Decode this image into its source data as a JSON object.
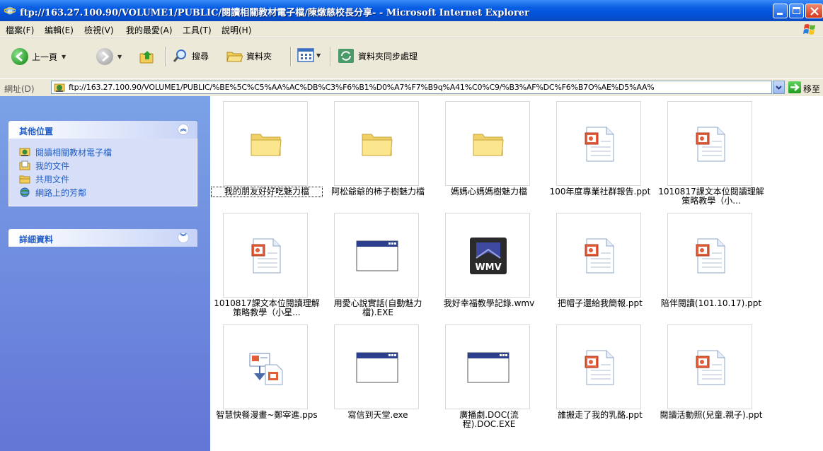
{
  "window": {
    "title": "ftp://163.27.100.90/VOLUME1/PUBLIC/閱讀相關教材電子檔/陳燉慈校長分享- - Microsoft Internet Explorer",
    "icon": "ie-icon"
  },
  "menu": {
    "items": [
      "檔案(F)",
      "編輯(E)",
      "檢視(V)",
      "我的最愛(A)",
      "工具(T)",
      "說明(H)"
    ]
  },
  "toolbar": {
    "back_label": "上一頁",
    "search_label": "搜尋",
    "folders_label": "資料夾",
    "sync_label": "資料夾同步處理"
  },
  "address": {
    "label": "網址(D)",
    "value": "ftp://163.27.100.90/VOLUME1/PUBLIC/%BE%5C%C5%AA%AC%DB%C3%F6%B1%D0%A7%F7%B9q%A41%C0%C9/%B3%AF%DC%F6%B7O%AE%D5%AA%",
    "go_label": "移至"
  },
  "taskpane": {
    "other_places": {
      "title": "其他位置",
      "links": [
        {
          "label": "閱讀相關教材電子檔",
          "icon": "ftp-folder-icon"
        },
        {
          "label": "我的文件",
          "icon": "my-documents-icon"
        },
        {
          "label": "共用文件",
          "icon": "shared-documents-icon"
        },
        {
          "label": "網路上的芳鄰",
          "icon": "network-places-icon"
        }
      ]
    },
    "details": {
      "title": "詳細資料"
    }
  },
  "files": [
    {
      "name": "我的朋友好好吃魅力檔",
      "type": "folder"
    },
    {
      "name": "阿松爺爺的柿子樹魅力檔",
      "type": "folder"
    },
    {
      "name": "媽媽心媽媽樹魅力檔",
      "type": "folder"
    },
    {
      "name": "100年度專業社群報告.ppt",
      "type": "ppt"
    },
    {
      "name": "1010817課文本位閱讀理解策略教學（小...",
      "type": "ppt"
    },
    {
      "name": "1010817課文本位閱讀理解策略教學（小星...",
      "type": "ppt"
    },
    {
      "name": "用愛心說實話(自動魅力檔).EXE",
      "type": "exe"
    },
    {
      "name": "我好幸福教學記錄.wmv",
      "type": "wmv",
      "badge": "WMV"
    },
    {
      "name": "把帽子還給我簡報.ppt",
      "type": "ppt"
    },
    {
      "name": "陪伴閱讀(101.10.17).ppt",
      "type": "ppt"
    },
    {
      "name": "智慧快餐漫畫~鄭宰進.pps",
      "type": "pps"
    },
    {
      "name": "寫信到天堂.exe",
      "type": "exe"
    },
    {
      "name": "廣播劇.DOC(流程).DOC.EXE",
      "type": "exe"
    },
    {
      "name": "誰搬走了我的乳酪.ppt",
      "type": "ppt"
    },
    {
      "name": "閱讀活動照(兒童.親子).ppt",
      "type": "ppt"
    }
  ]
}
